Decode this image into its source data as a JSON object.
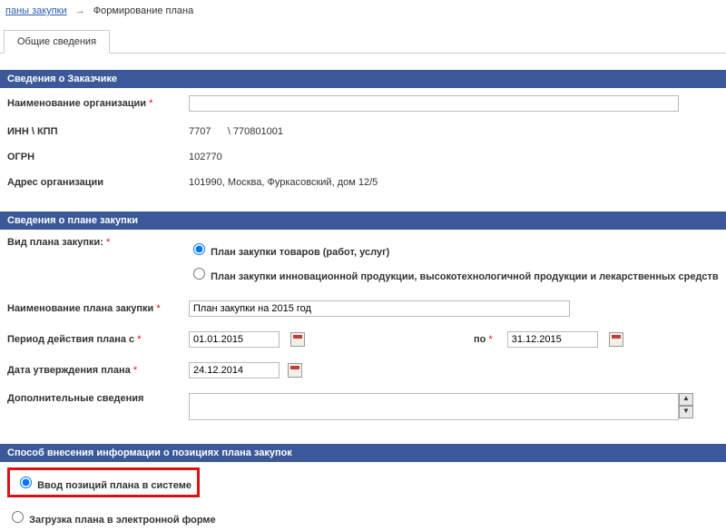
{
  "breadcrumb": {
    "link": "паны закупки",
    "current": "Формирование плана"
  },
  "tabs": {
    "general": "Общие сведения"
  },
  "sections": {
    "customer": "Сведения о Заказчике",
    "plan": "Сведения о плане закупки",
    "entry": "Способ внесения информации о позициях плана закупок"
  },
  "customer": {
    "org_name_label": "Наименование организации",
    "org_name_value": "",
    "inn_kpp_label": "ИНН \\ КПП",
    "inn_value": "7707",
    "kpp_value": "\\ 770801001",
    "ogrn_label": "ОГРН",
    "ogrn_value": "102770",
    "address_label": "Адрес организации",
    "address_value": "101990, Москва, Фуркасовский, дом 12/5"
  },
  "plan": {
    "type_label": "Вид плана закупки:",
    "type_option1": "План закупки товаров (работ, услуг)",
    "type_option2": "План закупки инновационной продукции, высокотехнологичной продукции и лекарственных средств",
    "name_label": "Наименование плана закупки",
    "name_value": "План закупки на 2015 год",
    "period_from_label": "Период действия плана с",
    "period_from_value": "01.01.2015",
    "period_to_label": "по",
    "period_to_value": "31.12.2015",
    "approved_label": "Дата утверждения плана",
    "approved_value": "24.12.2014",
    "additional_label": "Дополнительные сведения",
    "additional_value": ""
  },
  "entry": {
    "option1": "Ввод позиций плана в системе",
    "option2": "Загрузка плана в электронной форме"
  }
}
